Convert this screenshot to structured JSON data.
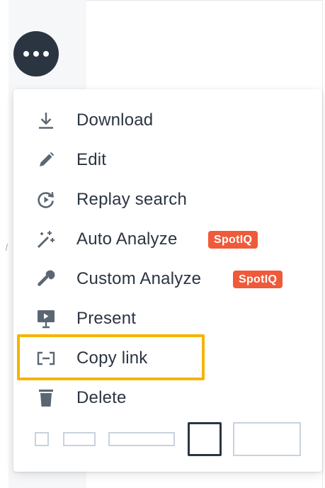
{
  "more_button": {
    "icon": "more-horizontal-icon"
  },
  "menu": {
    "items": [
      {
        "id": "download",
        "label": "Download",
        "icon": "download-icon"
      },
      {
        "id": "edit",
        "label": "Edit",
        "icon": "pencil-icon"
      },
      {
        "id": "replay-search",
        "label": "Replay search",
        "icon": "replay-icon"
      },
      {
        "id": "auto-analyze",
        "label": "Auto Analyze",
        "icon": "magic-wand-icon",
        "badge": "SpotIQ"
      },
      {
        "id": "custom-analyze",
        "label": "Custom Analyze",
        "icon": "wrench-icon",
        "badge": "SpotIQ"
      },
      {
        "id": "present",
        "label": "Present",
        "icon": "presentation-icon"
      },
      {
        "id": "copy-link",
        "label": "Copy link",
        "icon": "link-icon",
        "highlighted": true
      },
      {
        "id": "delete",
        "label": "Delete",
        "icon": "trash-icon"
      }
    ],
    "size_options": [
      {
        "id": "size-xs",
        "selected": false
      },
      {
        "id": "size-s",
        "selected": false
      },
      {
        "id": "size-m",
        "selected": false
      },
      {
        "id": "size-l",
        "selected": true
      },
      {
        "id": "size-xl",
        "selected": false
      }
    ]
  },
  "colors": {
    "text": "#2b3542",
    "icon": "#5b6673",
    "badge": "#ee5a3a",
    "highlight": "#f5b400",
    "more_button_bg": "#2b3542",
    "size_border": "#c9d2de",
    "size_selected_border": "#2b3542"
  }
}
